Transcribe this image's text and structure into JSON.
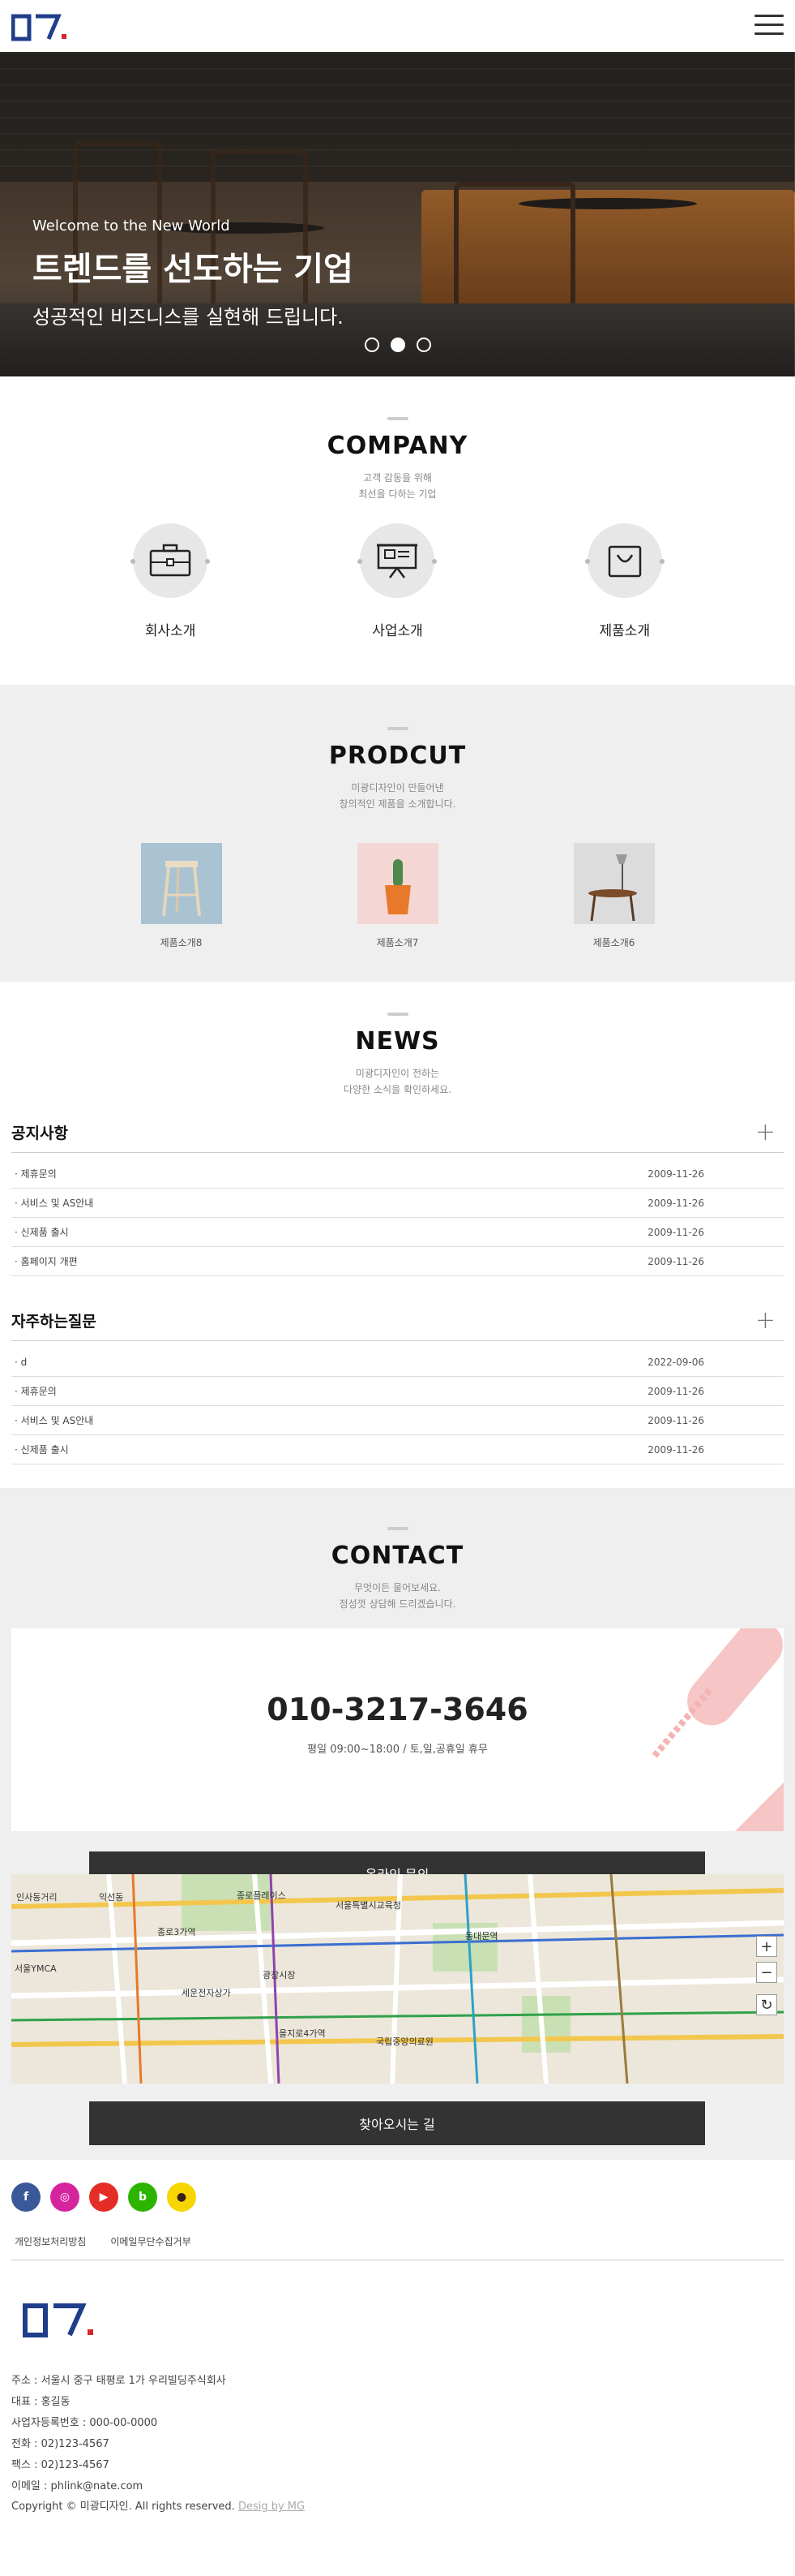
{
  "hero": {
    "kicker": "Welcome to the New World",
    "title": "트렌드를 선도하는 기업",
    "subtitle": "성공적인 비즈니스를 실현해 드립니다."
  },
  "company": {
    "title": "COMPANY",
    "desc1": "고객 감동을 위해",
    "desc2": "최선을 다하는 기업",
    "items": [
      {
        "label": "회사소개",
        "icon": "briefcase-icon"
      },
      {
        "label": "사업소개",
        "icon": "presentation-board-icon"
      },
      {
        "label": "제품소개",
        "icon": "shopping-bag-icon"
      }
    ]
  },
  "product": {
    "title": "PRODCUT",
    "desc1": "미광디자인이 만들어낸",
    "desc2": "창의적인 제품을 소개합니다.",
    "items": [
      {
        "label": "제품소개8"
      },
      {
        "label": "제품소개7"
      },
      {
        "label": "제품소개6"
      }
    ]
  },
  "news": {
    "title": "NEWS",
    "desc1": "미광디자인이 전하는",
    "desc2": "다양한 소식을 확인하세요.",
    "notice": {
      "title": "공지사항",
      "rows": [
        {
          "title": "· 제휴문의",
          "date": "2009-11-26"
        },
        {
          "title": "· 서비스 및 AS안내",
          "date": "2009-11-26"
        },
        {
          "title": "· 신제품 출시",
          "date": "2009-11-26"
        },
        {
          "title": "· 홈페이지 개편",
          "date": "2009-11-26"
        }
      ]
    },
    "faq": {
      "title": "자주하는질문",
      "rows": [
        {
          "title": "· d",
          "date": "2022-09-06"
        },
        {
          "title": "· 제휴문의",
          "date": "2009-11-26"
        },
        {
          "title": "· 서비스 및 AS안내",
          "date": "2009-11-26"
        },
        {
          "title": "· 신제품 출시",
          "date": "2009-11-26"
        }
      ]
    }
  },
  "contact": {
    "title": "CONTACT",
    "desc1": "무엇이든 물어보세요.",
    "desc2": "정성껏 상담해 드리겠습니다.",
    "phone": "010-3217-3646",
    "hours": "평일 09:00~18:00 / 토,일,공휴일 휴무",
    "inquiry_label": "온라인 문의",
    "directions_label": "찾아오시는 길",
    "map_labels": [
      "인사동거리",
      "익선동",
      "종로플레이스",
      "서울특별시교육청",
      "동대문역",
      "서울YMCA",
      "을지로4가역",
      "광장시장",
      "국립중앙의료원",
      "종로3가역",
      "세운전자상가"
    ]
  },
  "footer": {
    "sns": [
      {
        "name": "facebook-icon",
        "glyph": "f",
        "color": "#3b5998"
      },
      {
        "name": "instagram-icon",
        "glyph": "◎",
        "color": "#d6249f"
      },
      {
        "name": "youtube-icon",
        "glyph": "▶",
        "color": "#e52d27"
      },
      {
        "name": "blog-icon",
        "glyph": "b",
        "color": "#2db400"
      },
      {
        "name": "kakaotalk-icon",
        "glyph": "●",
        "color": "#f7d600"
      }
    ],
    "privacy_label": "개인정보처리방침",
    "email_policy_label": "이메일무단수집거부",
    "address": "주소 : 서울시 중구 태평로 1가 우리빌딩주식회사",
    "ceo": "대표 : 홍길동",
    "biz_no": "사업자등록번호 : 000-00-0000",
    "tel": "전화 : 02)123-4567",
    "fax": "팩스 : 02)123-4567",
    "email": "이메일 : phlink@nate.com",
    "copyright": "Copyright © 미광디자인. All rights reserved.",
    "credit": "Desig by MG"
  },
  "colors": {
    "logo": "#1f3d8a",
    "logo_accent": "#d4262c",
    "dark_button": "#333333",
    "section_gray": "#efefef"
  }
}
